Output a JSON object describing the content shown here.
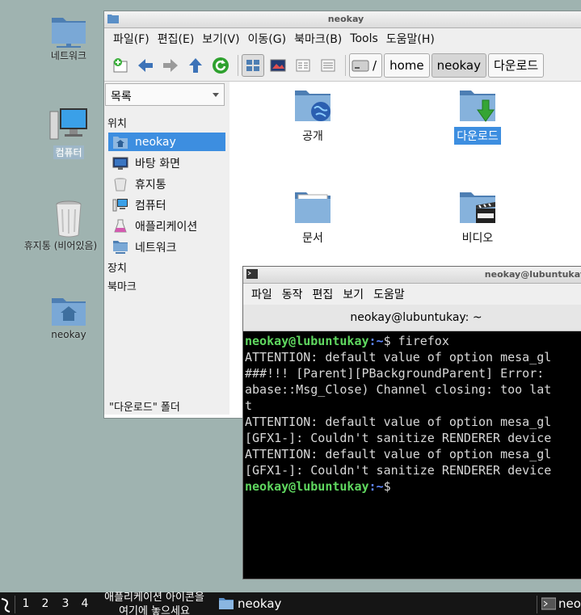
{
  "desktop": {
    "icons": [
      {
        "label": "네트워크"
      },
      {
        "label": "컴퓨터"
      },
      {
        "label": "휴지통 (비어있음)"
      },
      {
        "label": "neokay"
      }
    ]
  },
  "file_manager": {
    "title": "neokay",
    "menu": [
      "파일(F)",
      "편집(E)",
      "보기(V)",
      "이동(G)",
      "북마크(B)",
      "Tools",
      "도움말(H)"
    ],
    "path_root": "/",
    "breadcrumbs": [
      "home",
      "neokay",
      "다운로드"
    ],
    "side_combo": "목록",
    "section_places": "위치",
    "places": [
      "neokay",
      "바탕 화면",
      "휴지통",
      "컴퓨터",
      "애플리케이션",
      "네트워크"
    ],
    "section_devices": "장치",
    "section_bookmarks": "북마크",
    "status": "\"다운로드\" 폴더",
    "files": [
      "공개",
      "다운로드",
      "문서",
      "비디오"
    ]
  },
  "terminal": {
    "title": "neokay@lubuntukay",
    "menu": [
      "파일",
      "동작",
      "편집",
      "보기",
      "도움말"
    ],
    "tab": "neokay@lubuntukay: ~",
    "prompt_user": "neokay@lubuntukay",
    "prompt_path": ":~",
    "prompt_sym": "$ ",
    "command": "firefox",
    "lines": [
      "ATTENTION: default value of option mesa_gl",
      "",
      "###!!! [Parent][PBackgroundParent] Error: ",
      "abase::Msg_Close) Channel closing: too lat",
      "t",
      "",
      "ATTENTION: default value of option mesa_gl",
      "[GFX1-]: Couldn't sanitize RENDERER device",
      "ATTENTION: default value of option mesa_gl",
      "[GFX1-]: Couldn't sanitize RENDERER device",
      "",
      ""
    ]
  },
  "taskbar": {
    "desktops": [
      "1",
      "2",
      "3",
      "4"
    ],
    "launcher_hint_1": "애플리케이션 아이콘을",
    "launcher_hint_2": "여기에 놓으세요",
    "task_fm": "neokay",
    "task_term": "neo"
  },
  "colors": {
    "selection": "#3d8ee0",
    "desktop": "#9fb3b0",
    "prompt_user": "#5fd75f",
    "prompt_path": "#5f87ff"
  }
}
